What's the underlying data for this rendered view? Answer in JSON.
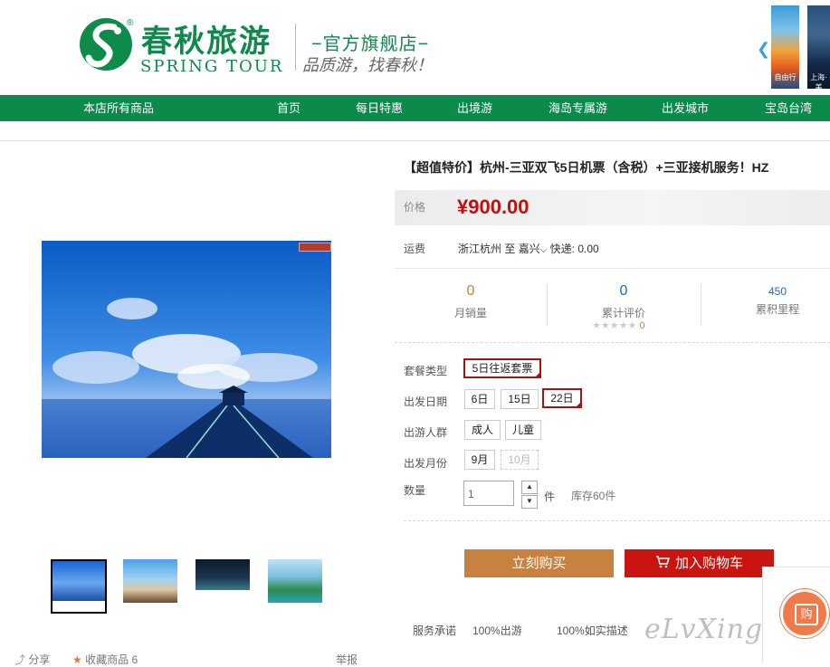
{
  "header": {
    "logo_cn": "春秋旅游",
    "logo_reg": "®",
    "logo_en": "SPRING TOUR",
    "store_name": "−官方旗舰店−",
    "slogan": "品质游，找春秋！",
    "banner1_text": "自由行",
    "banner2_text": "上海·美"
  },
  "nav": {
    "items": [
      "本店所有商品",
      "首页",
      "每日特惠",
      "出境游",
      "海岛专属游",
      "出发城市",
      "宝岛台湾"
    ]
  },
  "product": {
    "title": "【超值特价】杭州-三亚双飞5日机票（含税）+三亚接机服务！HZ",
    "price_label": "价格",
    "price": "¥900.00",
    "shipping_label": "运费",
    "shipping_from": "浙江杭州",
    "shipping_to_word": "至",
    "shipping_dest": "嘉兴",
    "shipping_method": "快递: 0.00"
  },
  "stats": {
    "sales_value": "0",
    "sales_label": "月销量",
    "reviews_value": "0",
    "reviews_label": "累计评价",
    "stars": "★★★★★",
    "rating_count": "0",
    "mileage_value": "450",
    "mileage_label": "累积里程"
  },
  "options": {
    "package_label": "套餐类型",
    "package_items": [
      "5日往返套票"
    ],
    "date_label": "出发日期",
    "date_items": [
      "6日",
      "15日",
      "22日"
    ],
    "people_label": "出游人群",
    "people_items": [
      "成人",
      "儿童"
    ],
    "month_label": "出发月份",
    "month_items": [
      "9月",
      "10月"
    ],
    "qty_label": "数量",
    "qty_value": "1",
    "qty_unit": "件",
    "stock": "库存60件"
  },
  "actions": {
    "buy_now": "立刻购买",
    "add_to_cart": "加入购物车"
  },
  "service": {
    "label": "服务承诺",
    "items": [
      "100%出游",
      "100%如实描述"
    ]
  },
  "bottom": {
    "share": "分享",
    "favorite": "收藏商品 6",
    "report": "举报"
  },
  "watermark": "eLvXing.net",
  "float_icon_text": "购"
}
